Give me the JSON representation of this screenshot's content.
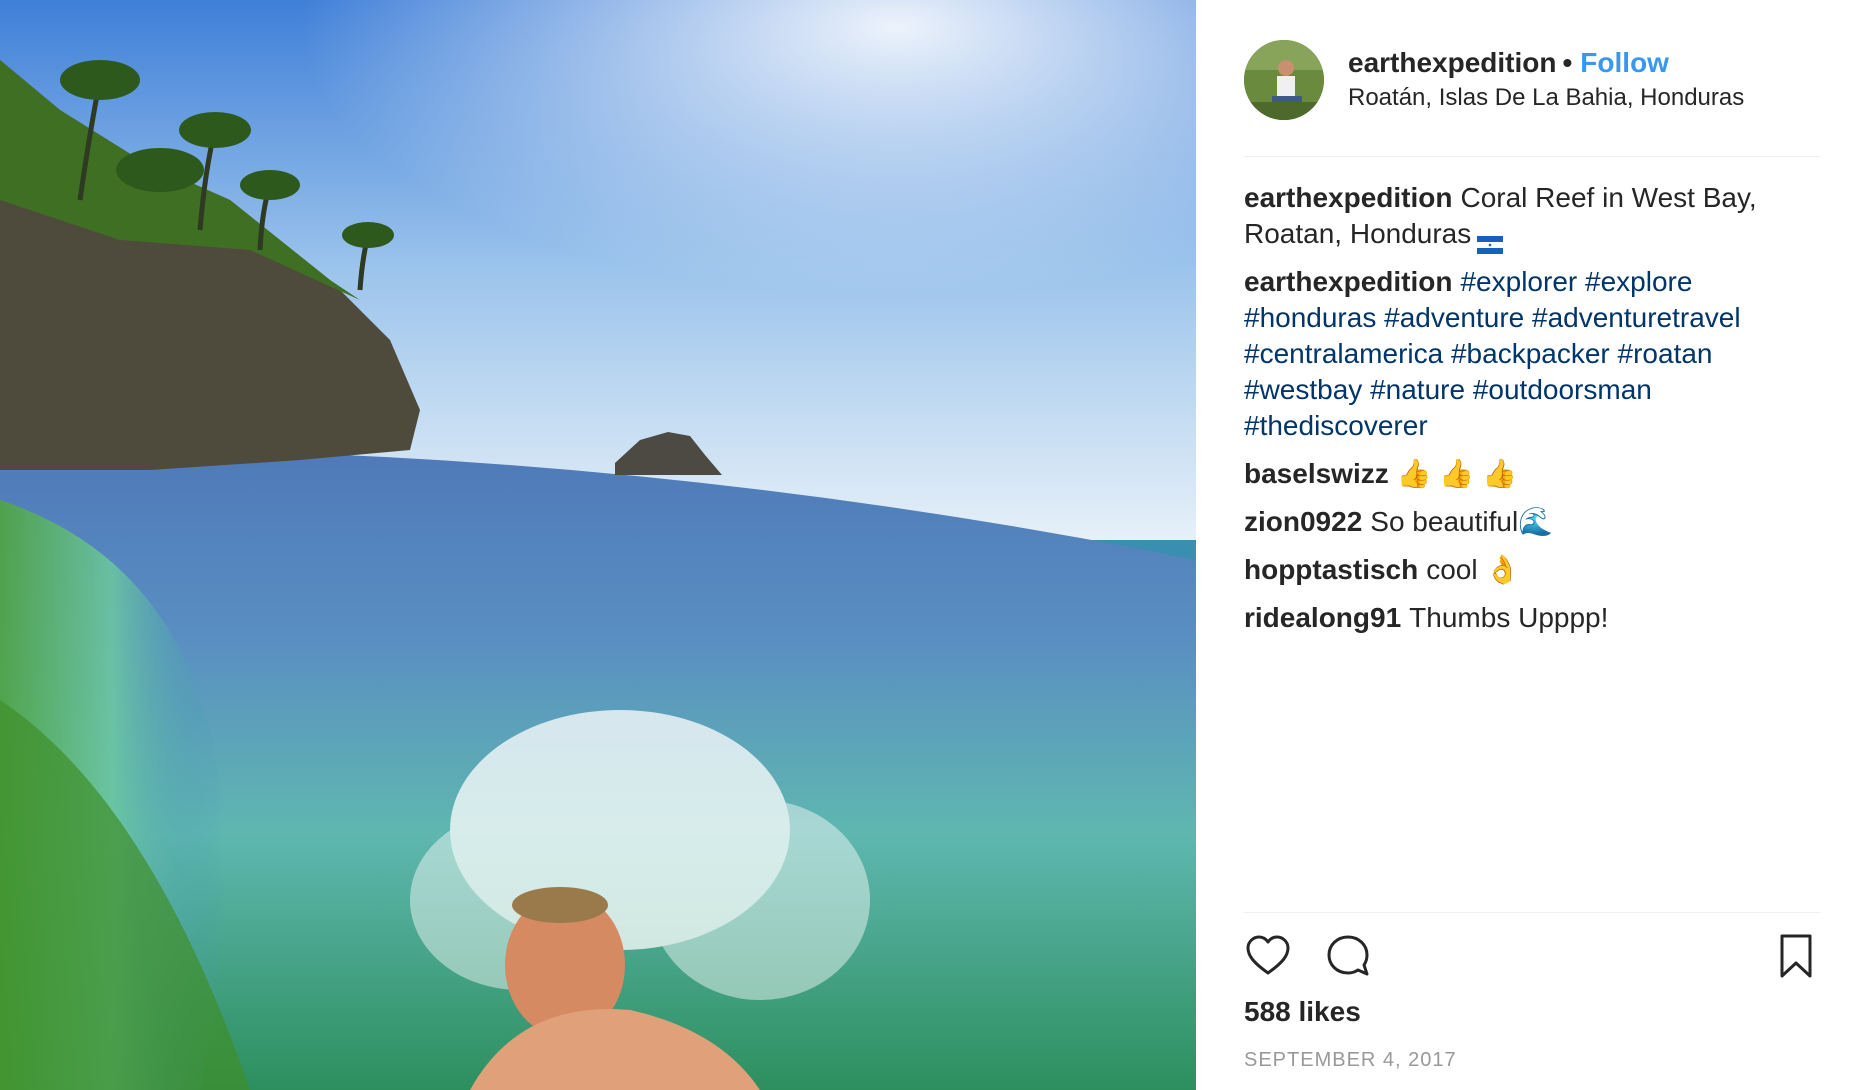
{
  "post": {
    "username": "earthexpedition",
    "separator": "•",
    "follow_label": "Follow",
    "location": "Roatán, Islas De La Bahia, Honduras",
    "icons": {
      "flag": "honduras-flag-icon",
      "like": "heart-icon",
      "comment": "comment-bubble-icon",
      "save": "bookmark-icon"
    }
  },
  "comments": [
    {
      "user": "earthexpedition",
      "text": "Coral Reef in West Bay, Roatan, Honduras",
      "hashtags": []
    },
    {
      "user": "earthexpedition",
      "text": "",
      "hashtags": [
        "#explorer",
        "#explore",
        "#honduras",
        "#adventure",
        "#adventuretravel",
        "#centralamerica",
        "#backpacker",
        "#roatan",
        "#westbay",
        "#nature",
        "#outdoorsman",
        "#thediscoverer"
      ]
    },
    {
      "user": "baselswizz",
      "text": "👍 👍 👍"
    },
    {
      "user": "zion0922",
      "text": "So beautiful🌊"
    },
    {
      "user": "hopptastisch",
      "text": "cool 👌"
    },
    {
      "user": "ridealong91",
      "text": "Thumbs Upppp!"
    }
  ],
  "stats": {
    "likes": "588 likes",
    "date": "SEPTEMBER 4, 2017"
  },
  "colors": {
    "link": "#3897f0",
    "hashtag": "#003569",
    "date": "#999999"
  }
}
